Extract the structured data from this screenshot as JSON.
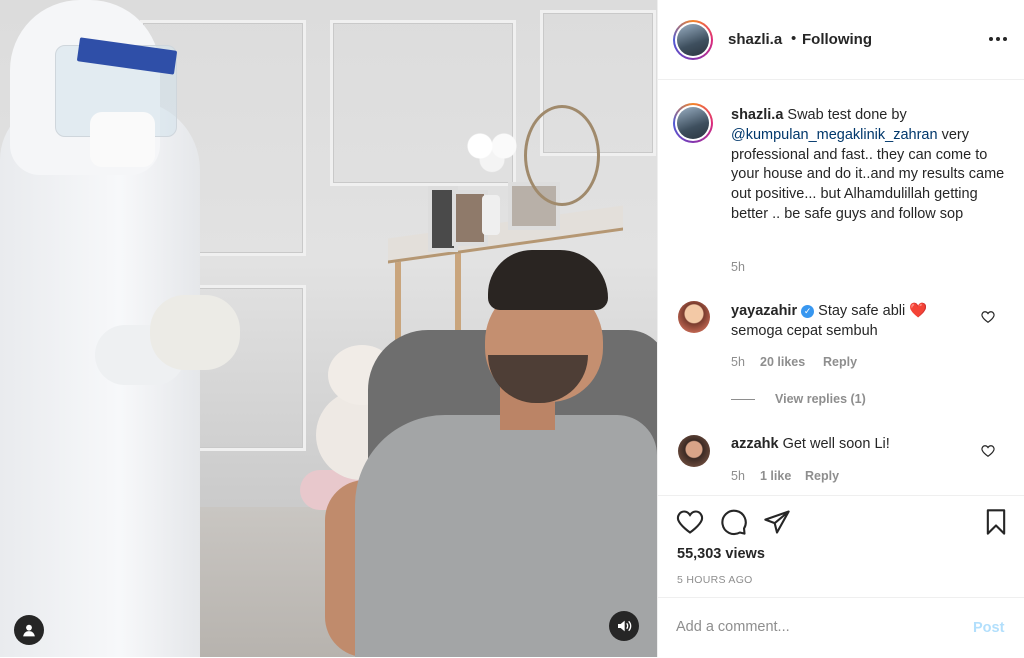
{
  "post": {
    "author": {
      "username": "shazli.a",
      "follow_status": "Following",
      "separator": "•"
    },
    "caption": {
      "username": "shazli.a",
      "text_before": " Swab test done by ",
      "mention": "@kumpulan_megaklinik_zahran",
      "text_after": " very professional and fast.. they can come to your house and do it..and my results came out positive... but Alhamdulillah getting better .. be safe guys and follow sop",
      "time": "5h"
    },
    "comments": [
      {
        "username": "yayazahir",
        "verified": true,
        "text": " Stay safe abli ❤️ semoga cepat sembuh",
        "time": "5h",
        "likes": "20 likes",
        "reply_label": "Reply",
        "view_replies": "View replies (1)"
      },
      {
        "username": "azzahk",
        "verified": false,
        "text": " Get well soon Li!",
        "time": "5h",
        "likes": "1 like",
        "reply_label": "Reply"
      }
    ],
    "views": "55,303 views",
    "time_ago": "5 HOURS AGO",
    "add_comment": {
      "placeholder": "Add a comment...",
      "post_label": "Post"
    }
  },
  "icons": {
    "more": "more-options-icon",
    "like": "heart-icon",
    "comment": "comment-icon",
    "share": "share-icon",
    "save": "bookmark-icon",
    "sound": "speaker-icon",
    "tagged": "user-tag-icon"
  },
  "colors": {
    "mention": "#00376b",
    "muted": "#8e8e8e",
    "post_disabled": "#b2dffc",
    "verified": "#3897f0"
  }
}
